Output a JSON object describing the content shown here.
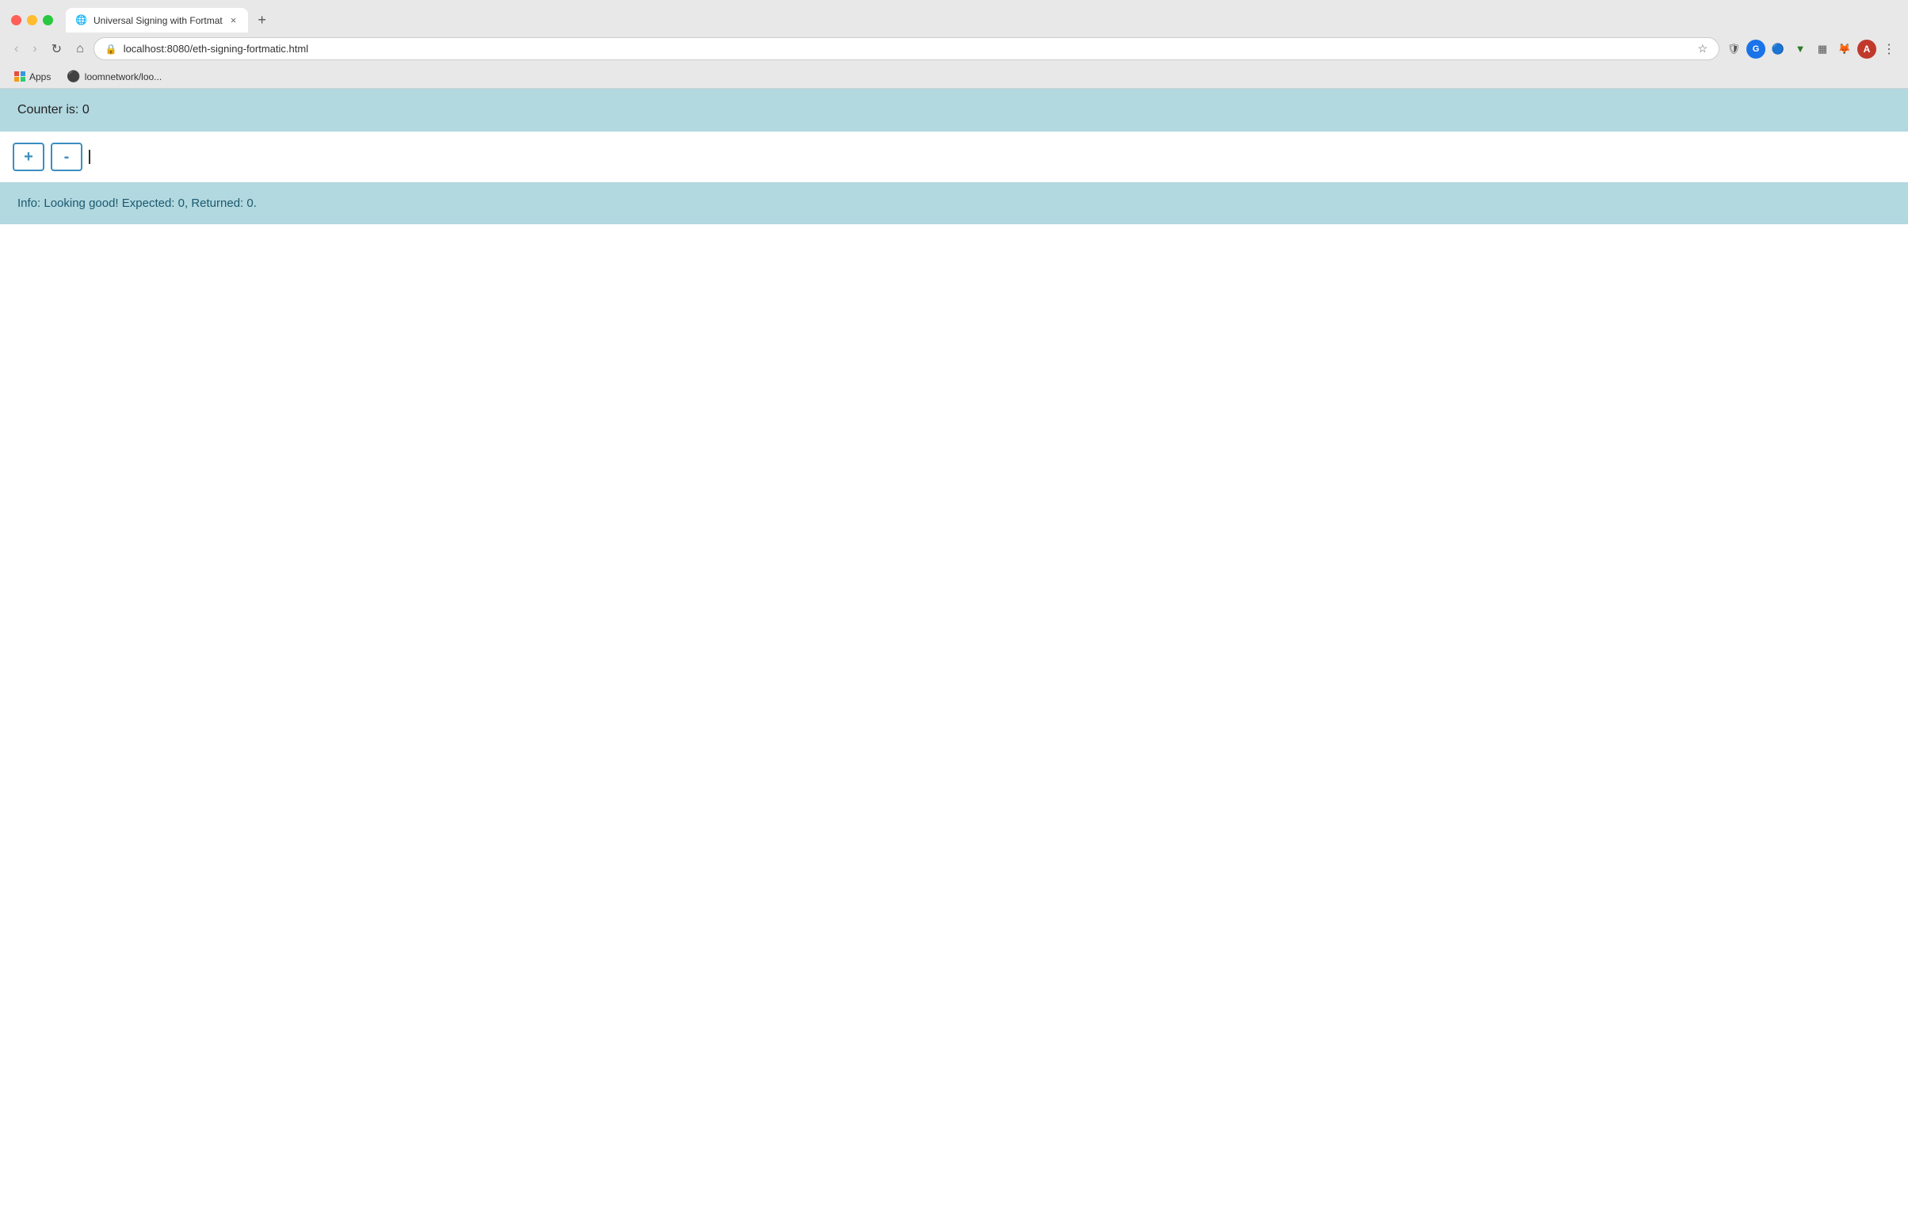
{
  "browser": {
    "traffic_lights": {
      "red": "tl-red",
      "yellow": "tl-yellow",
      "green": "tl-green"
    },
    "tab": {
      "title": "Universal Signing with Fortmat",
      "favicon_symbol": "🌐",
      "close_label": "×"
    },
    "new_tab_label": "+",
    "nav": {
      "back_label": "‹",
      "forward_label": "›",
      "reload_label": "↻",
      "home_label": "⌂",
      "address": "localhost:8080/eth-signing-fortmatic.html",
      "star_label": "☆",
      "shield_label": "🛡",
      "g_circle_label": "G",
      "vpn_label": "⬛",
      "arrow_down_label": "▼",
      "pixels_label": "▦",
      "fox_label": "🦊",
      "user_label": "A",
      "menu_label": "⋮"
    },
    "bookmarks": [
      {
        "icon": "⬛",
        "label": "Apps"
      },
      {
        "icon": "●",
        "label": "loomnetwork/loo..."
      }
    ]
  },
  "page": {
    "counter_label": "Counter is: 0",
    "increment_label": "+",
    "decrement_label": "-",
    "info_label": "Info: Looking good! Expected: 0, Returned: 0."
  }
}
